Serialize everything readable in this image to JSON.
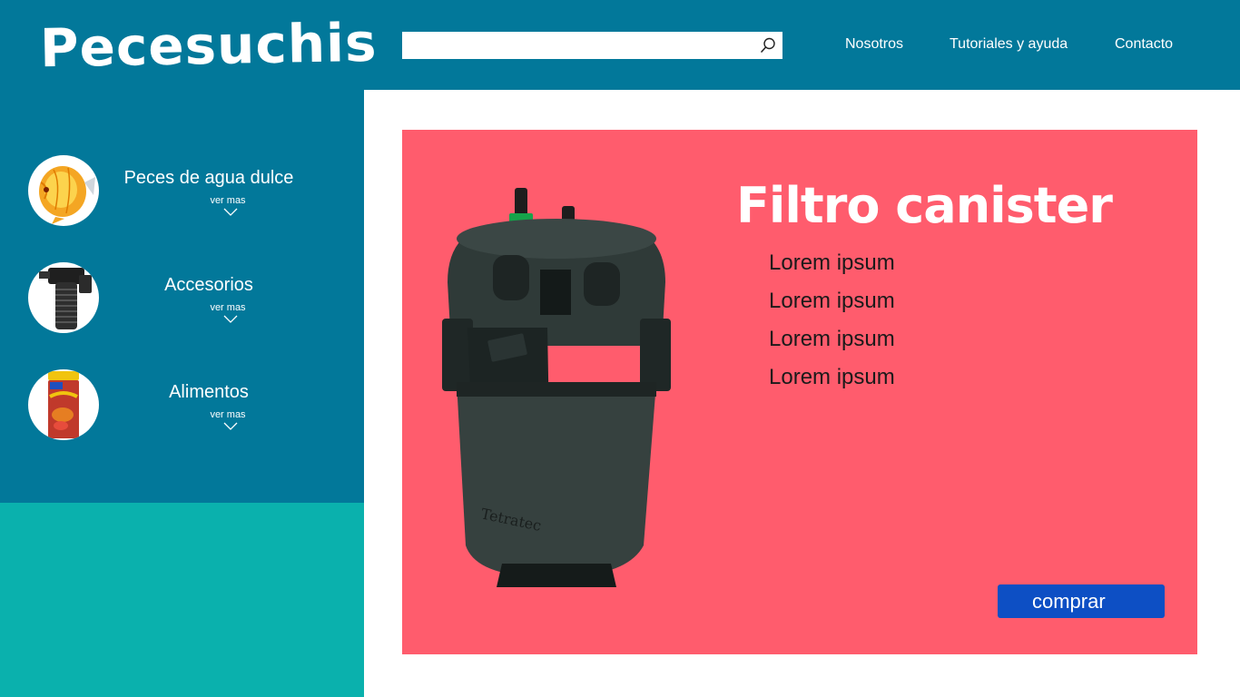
{
  "header": {
    "logo": "Pecesuchis",
    "search": {
      "value": "",
      "placeholder": ""
    },
    "nav": [
      {
        "label": "Nosotros"
      },
      {
        "label": "Tutoriales y ayuda"
      },
      {
        "label": "Contacto"
      }
    ]
  },
  "sidebar": {
    "categories": [
      {
        "label": "Peces de agua dulce",
        "more": "ver mas",
        "icon": "discus-fish-icon"
      },
      {
        "label": "Accesorios",
        "more": "ver mas",
        "icon": "aquarium-filter-icon"
      },
      {
        "label": "Alimentos",
        "more": "ver mas",
        "icon": "fish-food-can-icon"
      }
    ]
  },
  "promo": {
    "title": "Filtro canister",
    "features": [
      "Lorem ipsum",
      "Lorem ipsum",
      "Lorem ipsum",
      "Lorem ipsum"
    ],
    "buy_label": "comprar",
    "product_brand": "Tetratec"
  },
  "colors": {
    "header_bg": "#02789a",
    "sidebar_bottom_bg": "#0ab1ad",
    "promo_bg": "#ff5c6d",
    "buy_button": "#0d4fc4"
  }
}
